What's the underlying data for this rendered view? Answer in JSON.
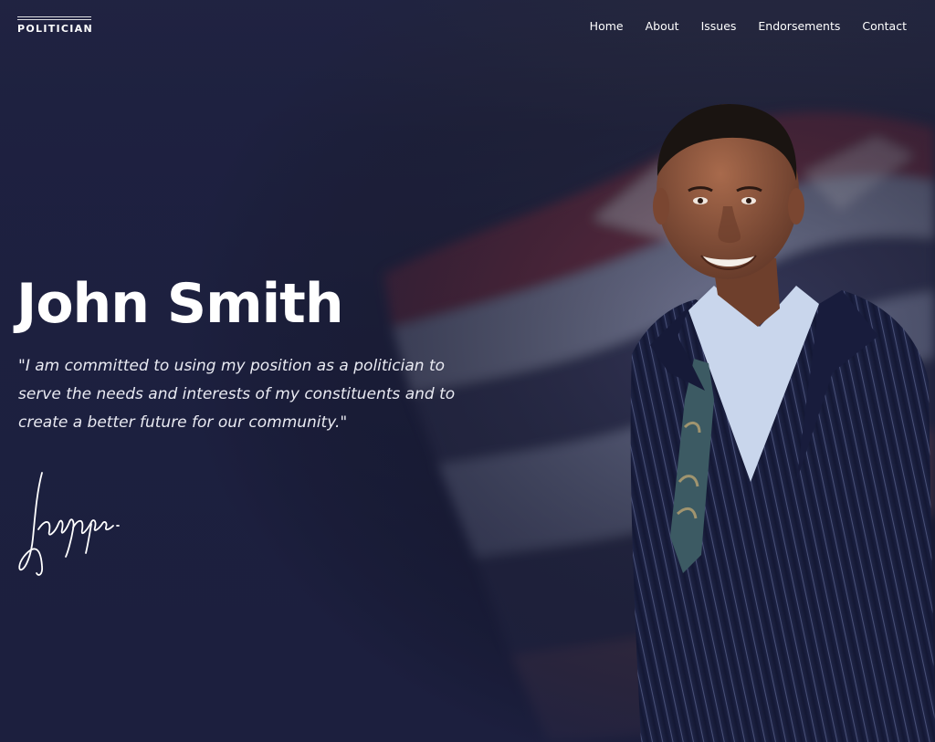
{
  "brand": {
    "logo_text": "POLITICIAN"
  },
  "nav": {
    "items": [
      {
        "label": "Home"
      },
      {
        "label": "About"
      },
      {
        "label": "Issues"
      },
      {
        "label": "Endorsements"
      },
      {
        "label": "Contact"
      }
    ]
  },
  "hero": {
    "name": "John Smith",
    "quote": "\"I am committed to using my position as a politician to serve the needs and interests of my constituents and to create a better future for our community.\"",
    "signature_icon": "signature-icon",
    "portrait_icon": "portrait-photo",
    "backdrop_icon": "american-flag-icon"
  },
  "colors": {
    "background_top": "#43465f",
    "background_bottom": "#1b1e3d",
    "text": "#ffffff",
    "quote_text": "#e9eaf2",
    "suit": "#1a1f3a",
    "shirt": "#c9d6ec"
  }
}
